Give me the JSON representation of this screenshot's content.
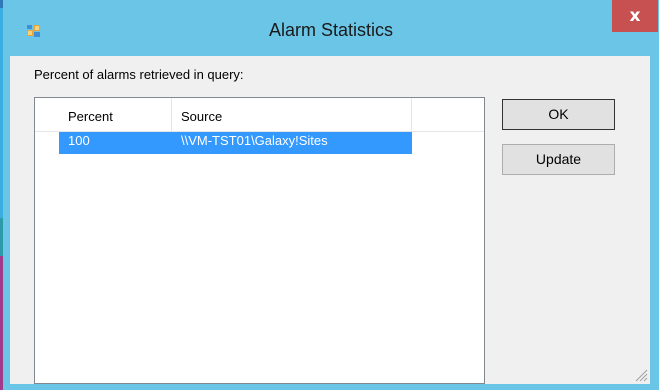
{
  "window": {
    "title": "Alarm Statistics",
    "close_glyph": "x"
  },
  "dialog": {
    "prompt": "Percent of alarms retrieved in query:",
    "columns": [
      "Percent",
      "Source"
    ],
    "rows": [
      {
        "percent": "100",
        "source": "\\\\VM-TST01\\Galaxy!Sites",
        "selected": true
      }
    ]
  },
  "buttons": {
    "ok_label": "OK",
    "update_label": "Update"
  },
  "colors": {
    "titlebar": "#6ac5e6",
    "close": "#c75050",
    "selection": "#3399ff"
  },
  "icons": {
    "app": "app-window-icon",
    "close": "close-icon",
    "grip": "resize-grip-icon"
  }
}
